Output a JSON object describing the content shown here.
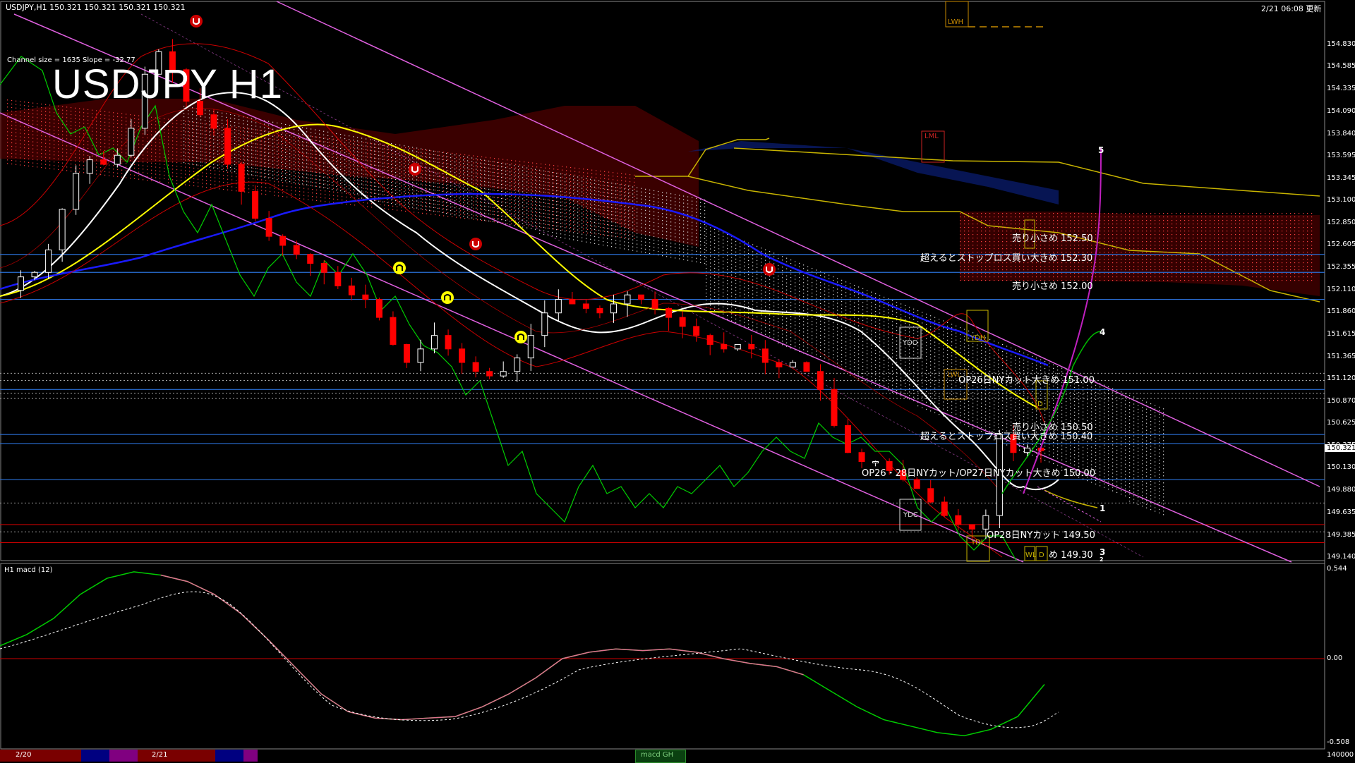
{
  "header": {
    "symbol_info": "USDJPY,H1  150.321 150.321 150.321 150.321",
    "datetime": "2/21 06:08 更新",
    "channel_info": "Channel size = 1635 Slope = -32.77",
    "big_title": "USDJPY H1"
  },
  "macd_panel": {
    "label": "H1  macd (12)",
    "ticks": [
      "0.544",
      "0.00",
      "-0.508"
    ],
    "bottom_value": "140000"
  },
  "bottom_bar": {
    "date1": "2/20",
    "date2": "2/21",
    "chip": "macd GH"
  },
  "price_tag": "150.321",
  "levels": [
    {
      "text": "売り小さめ 152.50"
    },
    {
      "text": "超えるとストップロス買い大きめ 152.30"
    },
    {
      "text": "売り小さめ 152.00"
    },
    {
      "text": "OP26日NYカット大きめ 151.00"
    },
    {
      "text": "売り小さめ 150.50"
    },
    {
      "text": "超えるとストップロス買い大きめ 150.40"
    },
    {
      "text": "OP26・28日NYカット/OP27日NYカット大きめ 150.00"
    },
    {
      "text": "OP28日NYカット 149.50"
    },
    {
      "text": "め 149.30"
    }
  ],
  "boxes": [
    "LWH",
    "LML",
    "YDH",
    "YDO",
    "LWL",
    "YDC",
    "YDL",
    "WL",
    "D",
    "D"
  ],
  "waves": [
    "5",
    "4",
    "1",
    "3",
    "2"
  ],
  "colors": {
    "background": "#000000",
    "bull_candle": "#ffffff",
    "bear_candle": "#ff0000",
    "channel": "#e060e0",
    "ma_white": "#ffffff",
    "ma_yellow": "#ffff00",
    "ma_blue": "#1a1aff",
    "chikou": "#00cc00",
    "level_line": "#2a6fd6",
    "macd_line": "#00cc00",
    "signal_line": "#ffffff"
  },
  "chart_data": {
    "type": "candlestick",
    "symbol": "USDJPY",
    "timeframe": "H1",
    "y_ticks": [
      "154.830",
      "154.585",
      "154.335",
      "154.090",
      "153.840",
      "153.595",
      "153.345",
      "153.100",
      "152.850",
      "152.605",
      "152.355",
      "152.110",
      "151.860",
      "151.615",
      "151.365",
      "151.120",
      "150.870",
      "150.625",
      "150.375",
      "150.130",
      "149.880",
      "149.635",
      "149.385",
      "149.140"
    ],
    "ylim": [
      149.1,
      155.05
    ],
    "close_path": [
      152.1,
      152.25,
      152.3,
      152.55,
      153.0,
      153.4,
      153.55,
      153.5,
      153.6,
      153.9,
      154.5,
      154.75,
      154.55,
      154.2,
      154.05,
      153.9,
      153.5,
      153.2,
      152.9,
      152.7,
      152.6,
      152.5,
      152.4,
      152.3,
      152.15,
      152.05,
      152.0,
      151.8,
      151.5,
      151.3,
      151.45,
      151.6,
      151.45,
      151.3,
      151.2,
      151.15,
      151.2,
      151.35,
      151.6,
      151.85,
      152.0,
      151.95,
      151.9,
      151.85,
      151.95,
      152.05,
      152.0,
      151.9,
      151.8,
      151.7,
      151.6,
      151.5,
      151.45,
      151.5,
      151.45,
      151.3,
      151.25,
      151.3,
      151.2,
      151.0,
      150.6,
      150.3,
      150.2,
      150.2,
      150.1,
      150.0,
      149.9,
      149.75,
      149.6,
      149.5,
      149.45,
      149.6,
      150.5,
      150.3,
      150.35,
      150.32
    ],
    "macd_values": [
      0.08,
      0.15,
      0.25,
      0.4,
      0.5,
      0.54,
      0.52,
      0.48,
      0.4,
      0.28,
      0.12,
      -0.05,
      -0.22,
      -0.33,
      -0.37,
      -0.38,
      -0.37,
      -0.36,
      -0.3,
      -0.22,
      -0.12,
      0.0,
      0.04,
      0.06,
      0.05,
      0.06,
      0.04,
      0.0,
      -0.03,
      -0.05,
      -0.1,
      -0.2,
      -0.3,
      -0.38,
      -0.42,
      -0.46,
      -0.48,
      -0.44,
      -0.36,
      -0.16
    ]
  }
}
